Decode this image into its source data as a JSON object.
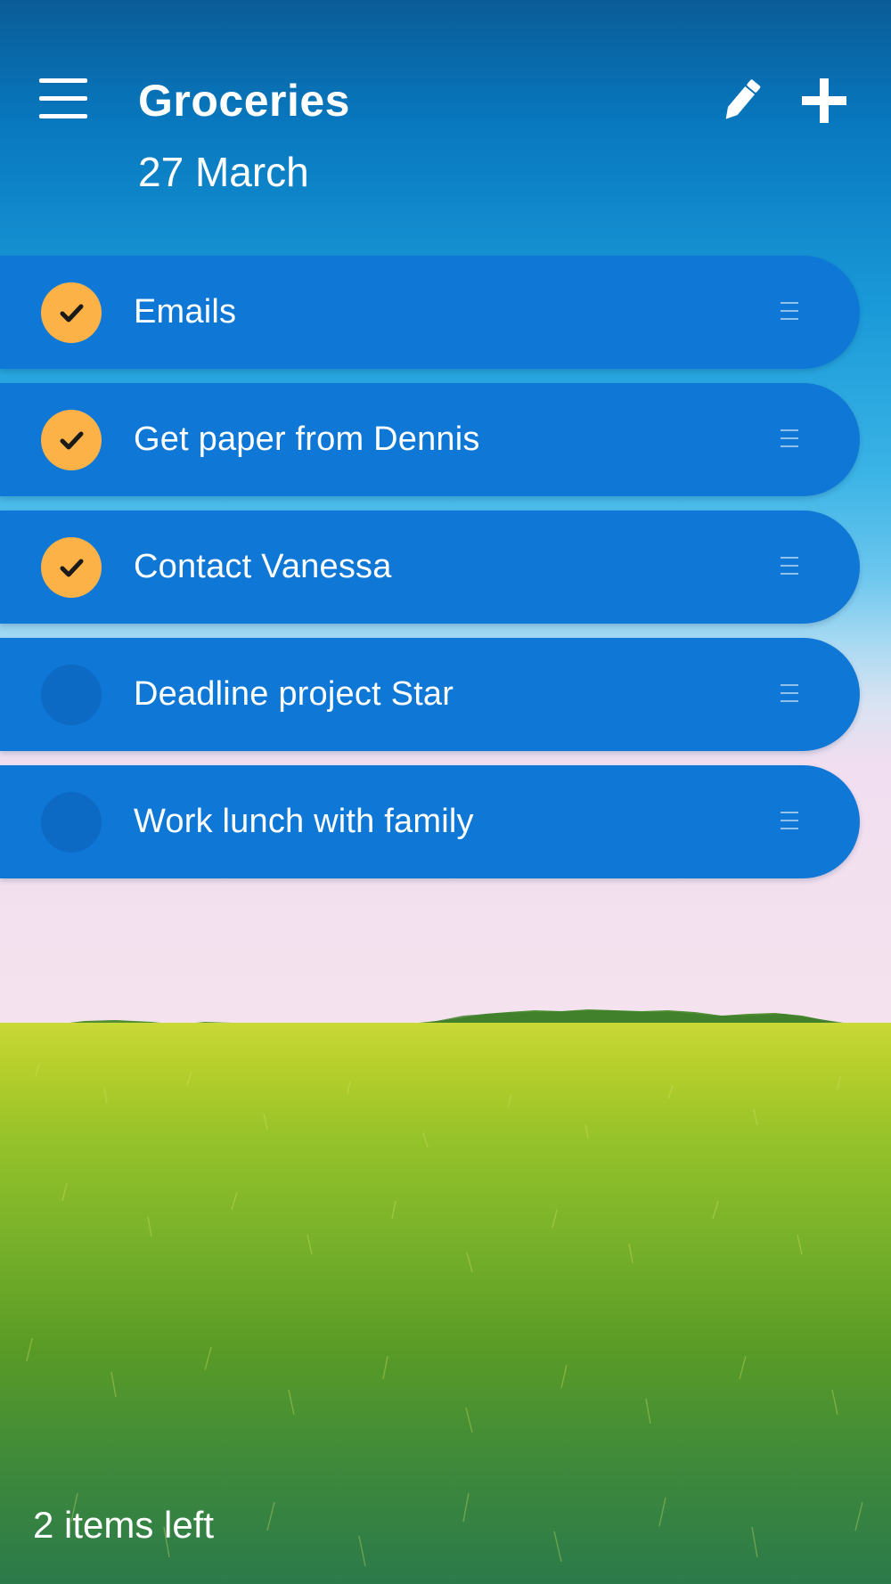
{
  "header": {
    "title": "Groceries",
    "date": "27 March",
    "menu_icon": "hamburger-menu-icon",
    "edit_icon": "pencil-icon",
    "add_icon": "plus-icon"
  },
  "tasks": [
    {
      "label": "Emails",
      "done": true
    },
    {
      "label": "Get paper from Dennis",
      "done": true
    },
    {
      "label": "Contact Vanessa",
      "done": true
    },
    {
      "label": "Deadline project Star",
      "done": false
    },
    {
      "label": "Work lunch with family",
      "done": false
    }
  ],
  "footer": {
    "items_left": "2 items left"
  },
  "colors": {
    "row_background": "#0f78d6",
    "check_done": "#fdb247",
    "check_todo": "#0d6ac4"
  }
}
